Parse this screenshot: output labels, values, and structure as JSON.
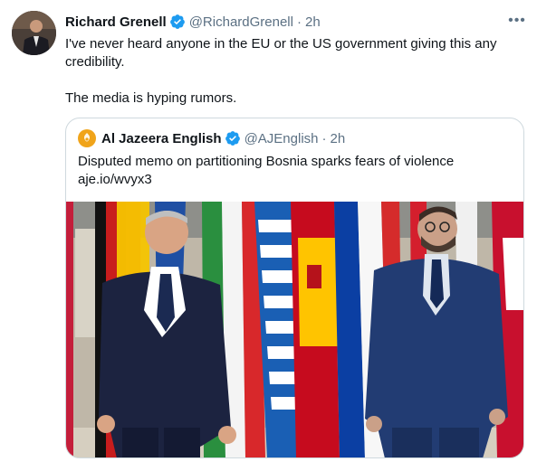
{
  "tweet": {
    "author_name": "Richard Grenell",
    "author_handle": "@RichardGrenell",
    "separator": "·",
    "time": "2h",
    "more_label": "•••",
    "text_line1": "I've never heard anyone in the EU or the US government giving this any credibility.",
    "text_line2": "The media is hyping rumors."
  },
  "quote": {
    "author_name": "Al Jazeera English",
    "author_handle": "@AJEnglish",
    "separator": "·",
    "time": "2h",
    "text": "Disputed memo on partitioning Bosnia sparks fears of violence",
    "link": "aje.io/wvyx3"
  },
  "colors": {
    "verified": "#1d9bf0",
    "secondary_text": "#5b7083",
    "border": "#cfd9de",
    "aj_logo": "#f0a41a"
  },
  "icons": [
    "verified-badge-icon",
    "more-options-icon",
    "al-jazeera-logo-icon"
  ]
}
